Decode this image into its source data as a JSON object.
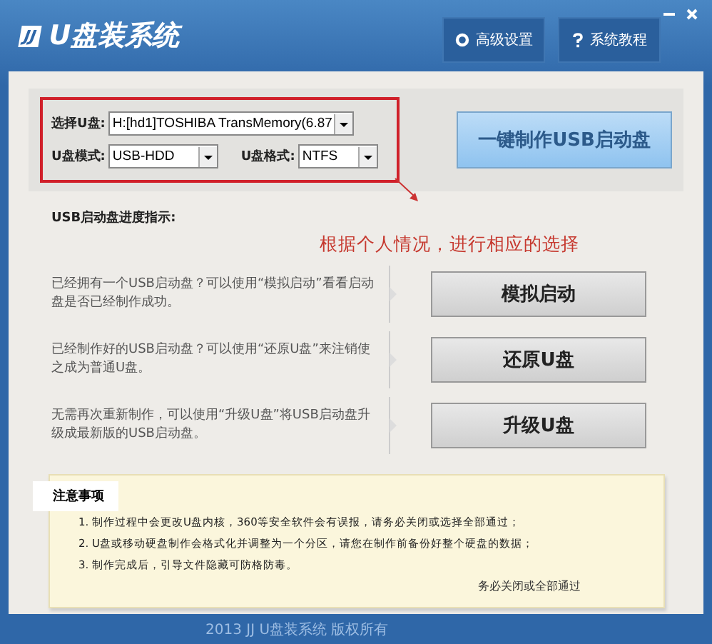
{
  "window": {
    "logo": "JJ",
    "title": "U盘装系统",
    "buttons": [
      {
        "kind": "settings",
        "label": "高级设置"
      },
      {
        "kind": "help",
        "label": "系统教程"
      }
    ]
  },
  "selector": {
    "drive_label": "选择U盘:",
    "drive_value": "H:[hd1]TOSHIBA TransMemory(6.87",
    "mode_label": "U盘模式:",
    "mode_value": "USB-HDD",
    "format_label": "U盘格式:",
    "format_value": "NTFS",
    "make_button": "一键制作USB启动盘"
  },
  "progress_label": "USB启动盘进度指示:",
  "annotation": "根据个人情况，进行相应的选择",
  "actions": [
    {
      "description": "已经拥有一个USB启动盘？可以使用“模拟启动”看看启动盘是否已经制作成功。",
      "button": "模拟启动"
    },
    {
      "description": "已经制作好的USB启动盘？可以使用“还原U盘”来注销使之成为普通U盘。",
      "button": "还原U盘"
    },
    {
      "description": "无需再次重新制作，可以使用“升级U盘”将USB启动盘升级成最新版的USB启动盘。",
      "button": "升级U盘"
    }
  ],
  "notes": {
    "title": "注意事项",
    "items": [
      "1. 制作过程中会更改U盘内核，360等安全软件会有误报，请务必关闭或选择全部通过；",
      "2. U盘或移动硬盘制作会格式化并调整为一个分区，请您在制作前备份好整个硬盘的数据；",
      "3. 制作完成后，引导文件隐藏可防格防毒。"
    ],
    "overlay_text": "务必关闭或全部通过"
  },
  "footer": "2013 JJ U盘装系统 版权所有"
}
